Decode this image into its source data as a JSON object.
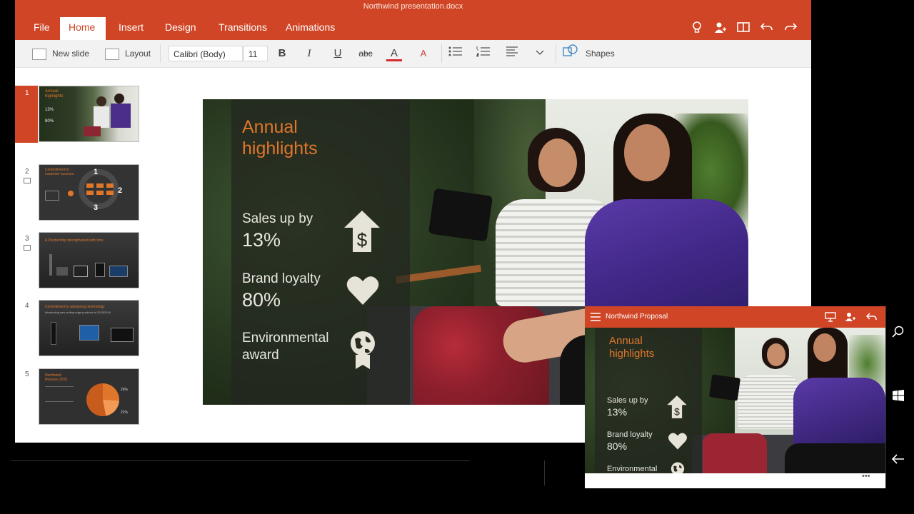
{
  "app": {
    "document_title": "Northwind presentation.docx",
    "tabs": [
      "File",
      "Home",
      "Insert",
      "Design",
      "Transitions",
      "Animations"
    ],
    "active_tab": "Home",
    "toolbar_icons": [
      "lightbulb-icon",
      "share-user-icon",
      "reading-view-icon",
      "undo-icon",
      "redo-icon"
    ]
  },
  "ribbon": {
    "new_slide_label": "New slide",
    "layout_label": "Layout",
    "font_name": "Calibri (Body)",
    "font_size": "11",
    "bold": "B",
    "italic": "I",
    "underline": "U",
    "strike": "abc",
    "font_color": "A",
    "clear_format": "A",
    "shapes_label": "Shapes"
  },
  "thumbnails": {
    "numbers": [
      "1",
      "2",
      "3",
      "4",
      "5"
    ],
    "selected": "1",
    "t1": {
      "title": "Annual highlights",
      "v1": "13%",
      "v2": "80%"
    },
    "t2": {
      "title": "Commitment to customer success",
      "n1": "1",
      "n2": "2",
      "n3": "3"
    },
    "t3": {
      "title": "A Partnership strengthened with time"
    },
    "t4": {
      "title": "Commitment to advancing technology",
      "sub": "Introducing new cutting edge products in 2015/2016"
    },
    "t5": {
      "title": "Northwind finances 2015",
      "p1": "26%",
      "p2": "21%"
    }
  },
  "slide": {
    "title": "Annual highlights",
    "items": [
      {
        "label": "Sales up by",
        "value": "13%",
        "icon": "dollar-arrow-icon"
      },
      {
        "label": "Brand loyalty",
        "value": "80%",
        "icon": "heart-icon"
      },
      {
        "label": "Environmental",
        "value": "award",
        "icon": "globe-award-icon"
      }
    ]
  },
  "phone": {
    "title": "Northwind Proposal",
    "more": "•••",
    "nav_icons": [
      "search-icon",
      "windows-icon",
      "back-icon"
    ]
  },
  "colors": {
    "accent": "#d04526",
    "slide_orange": "#e0762a"
  }
}
